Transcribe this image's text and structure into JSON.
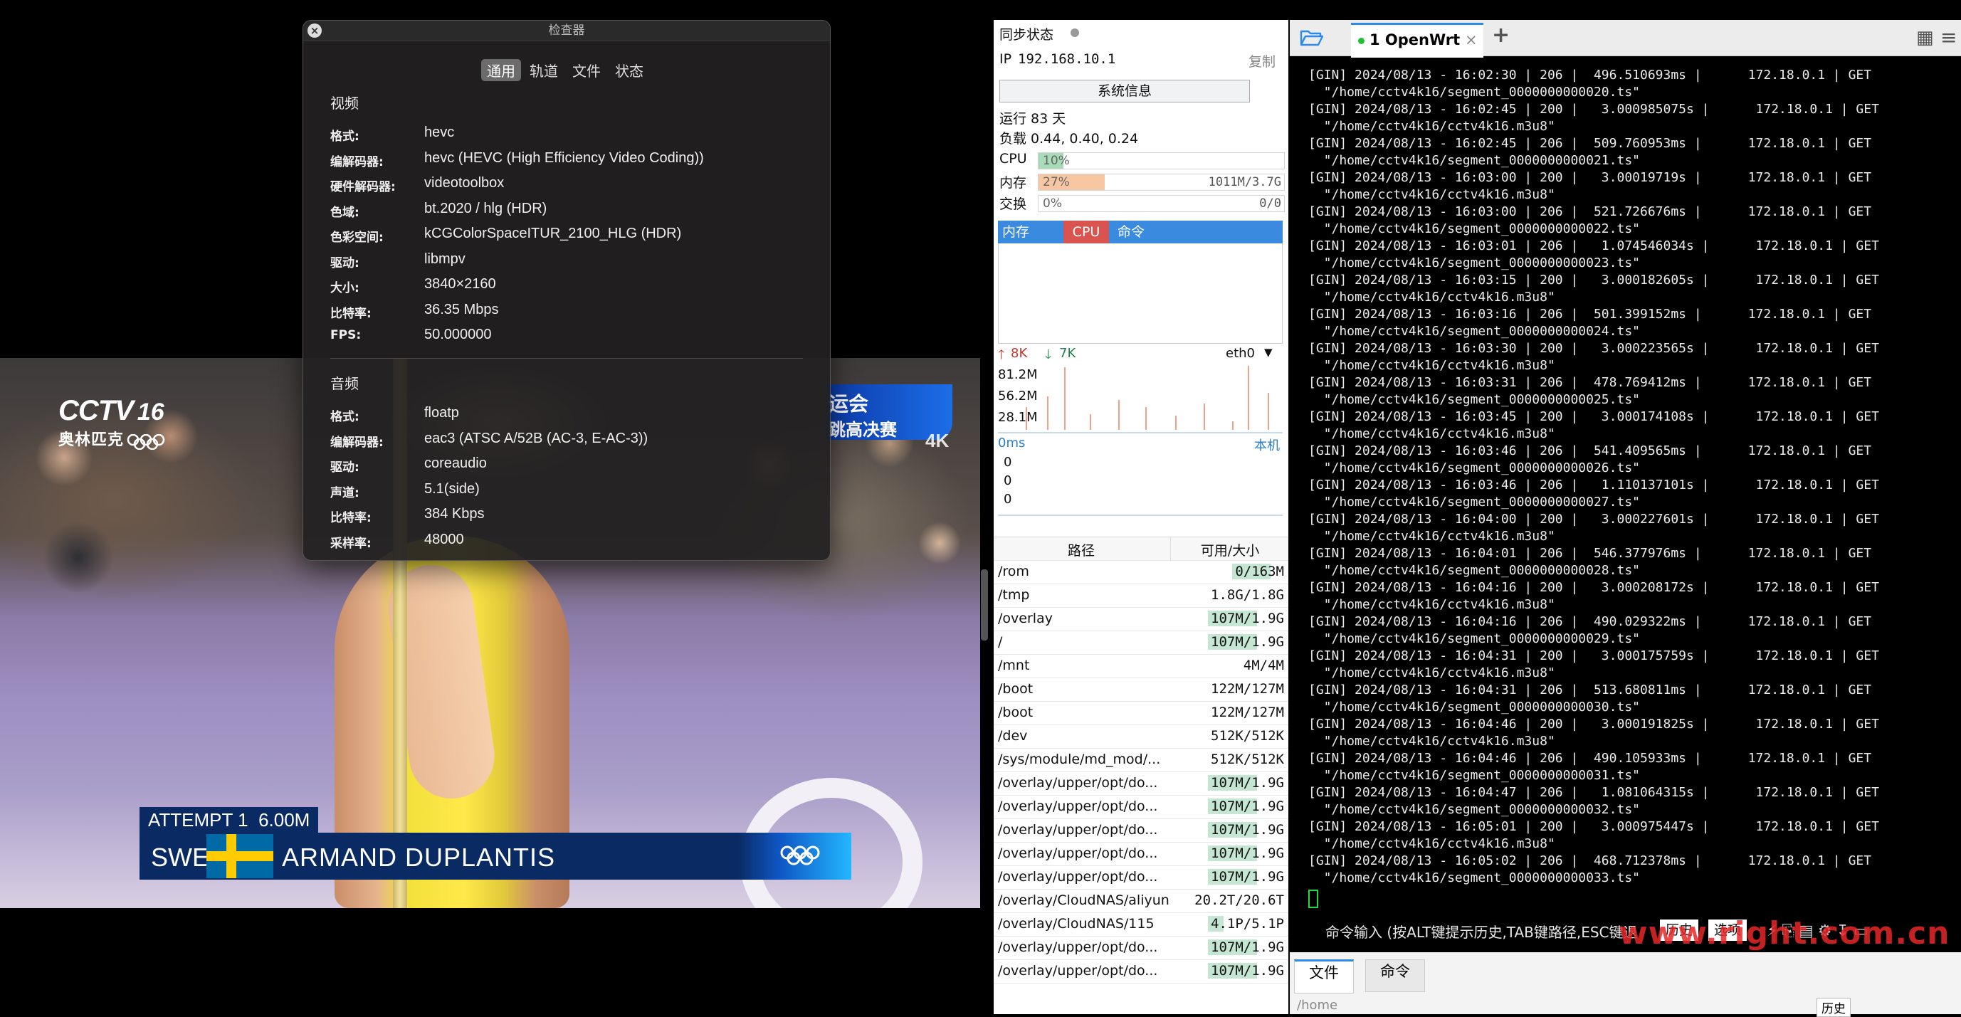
{
  "inspector": {
    "title": "检查器",
    "tabs": [
      "通用",
      "轨道",
      "文件",
      "状态"
    ],
    "video_title": "视频",
    "video_rows": [
      {
        "k": "格式:",
        "v": "hevc"
      },
      {
        "k": "编解码器:",
        "v": "hevc (HEVC (High Efficiency Video Coding))"
      },
      {
        "k": "硬件解码器:",
        "v": "videotoolbox"
      },
      {
        "k": "色域:",
        "v": "bt.2020 / hlg (HDR)"
      },
      {
        "k": "色彩空间:",
        "v": "kCGColorSpaceITUR_2100_HLG (HDR)"
      },
      {
        "k": "驱动:",
        "v": "libmpv"
      },
      {
        "k": "大小:",
        "v": "3840×2160"
      },
      {
        "k": "比特率:",
        "v": "36.35 Mbps"
      },
      {
        "k": "FPS:",
        "v": "50.000000"
      }
    ],
    "audio_title": "音频",
    "audio_rows": [
      {
        "k": "格式:",
        "v": "floatp"
      },
      {
        "k": "编解码器:",
        "v": "eac3 (ATSC A/52B (AC-3, E-AC-3))"
      },
      {
        "k": "驱动:",
        "v": "coreaudio"
      },
      {
        "k": "声道:",
        "v": "5.1(side)"
      },
      {
        "k": "比特率:",
        "v": "384 Kbps"
      },
      {
        "k": "采样率:",
        "v": "48000"
      }
    ]
  },
  "video": {
    "channel": "CCTV",
    "channel_num": "16",
    "channel_sub": "奥林匹克",
    "badge": "4K",
    "event_line1": "运会",
    "event_line2": "跳高决赛",
    "attempt": "ATTEMPT 1",
    "height": "6.00M",
    "country": "SWE",
    "athlete": "ARMAND DUPLANTIS"
  },
  "wrt": {
    "sync_label": "同步状态",
    "ip_label": "IP",
    "ip": "192.168.10.1",
    "copy": "复制",
    "sysinfo_btn": "系统信息",
    "uptime": "运行 83 天",
    "load": "负载 0.44, 0.40, 0.24",
    "cpu_label": "CPU",
    "cpu_pct": "10%",
    "cpu_fraction": 0.1,
    "mem_label": "内存",
    "mem_pct": "27%",
    "mem_amount": "1011M/3.7G",
    "mem_fraction": 0.27,
    "swap_label": "交换",
    "swap_pct": "0%",
    "swap_amount": "0/0",
    "proc_tabs": [
      "内存",
      "CPU",
      "命令"
    ],
    "net_up": "8K",
    "net_down": "7K",
    "iface": "eth0",
    "net_ticks": [
      "81.2M",
      "56.2M",
      "28.1M"
    ],
    "ping_label": "0ms",
    "ping_host": "本机",
    "ping_ticks": [
      "0",
      "0",
      "0"
    ],
    "disk_head_path": "路径",
    "disk_head_size": "可用/大小",
    "disks": [
      {
        "path": "/rom",
        "size": "0/163M",
        "used": 0.7
      },
      {
        "path": "/tmp",
        "size": "1.8G/1.8G",
        "used": 0
      },
      {
        "path": "/overlay",
        "size": "107M/1.9G",
        "used": 0.62
      },
      {
        "path": "/",
        "size": "107M/1.9G",
        "used": 0.62
      },
      {
        "path": "/mnt",
        "size": "4M/4M",
        "used": 0
      },
      {
        "path": "/boot",
        "size": "122M/127M",
        "used": 0
      },
      {
        "path": "/boot",
        "size": "122M/127M",
        "used": 0
      },
      {
        "path": "/dev",
        "size": "512K/512K",
        "used": 0
      },
      {
        "path": "/sys/module/md_mod/...",
        "size": "512K/512K",
        "used": 0
      },
      {
        "path": "/overlay/upper/opt/do...",
        "size": "107M/1.9G",
        "used": 0.62
      },
      {
        "path": "/overlay/upper/opt/do...",
        "size": "107M/1.9G",
        "used": 0.62
      },
      {
        "path": "/overlay/upper/opt/do...",
        "size": "107M/1.9G",
        "used": 0.62
      },
      {
        "path": "/overlay/upper/opt/do...",
        "size": "107M/1.9G",
        "used": 0.62
      },
      {
        "path": "/overlay/upper/opt/do...",
        "size": "107M/1.9G",
        "used": 0.62
      },
      {
        "path": "/overlay/CloudNAS/aliyun",
        "size": "20.2T/20.6T",
        "used": 0
      },
      {
        "path": "/overlay/CloudNAS/115",
        "size": "4.1P/5.1P",
        "used": 0.2
      },
      {
        "path": "/overlay/upper/opt/do...",
        "size": "107M/1.9G",
        "used": 0.62
      },
      {
        "path": "/overlay/upper/opt/do...",
        "size": "107M/1.9G",
        "used": 0.62
      }
    ]
  },
  "terminal": {
    "tab_label": "1 OpenWrt",
    "log": [
      "[GIN] 2024/08/13 - 16:02:30 | 206 |  496.510693ms |      172.18.0.1 | GET",
      "  \"/home/cctv4k16/segment_0000000000020.ts\"",
      "[GIN] 2024/08/13 - 16:02:45 | 200 |   3.000985075s |      172.18.0.1 | GET",
      "  \"/home/cctv4k16/cctv4k16.m3u8\"",
      "[GIN] 2024/08/13 - 16:02:45 | 206 |  509.760953ms |      172.18.0.1 | GET",
      "  \"/home/cctv4k16/segment_0000000000021.ts\"",
      "[GIN] 2024/08/13 - 16:03:00 | 200 |   3.00019719s |      172.18.0.1 | GET",
      "  \"/home/cctv4k16/cctv4k16.m3u8\"",
      "[GIN] 2024/08/13 - 16:03:00 | 206 |  521.726676ms |      172.18.0.1 | GET",
      "  \"/home/cctv4k16/segment_0000000000022.ts\"",
      "[GIN] 2024/08/13 - 16:03:01 | 206 |   1.074546034s |      172.18.0.1 | GET",
      "  \"/home/cctv4k16/segment_0000000000023.ts\"",
      "[GIN] 2024/08/13 - 16:03:15 | 200 |   3.000182605s |      172.18.0.1 | GET",
      "  \"/home/cctv4k16/cctv4k16.m3u8\"",
      "[GIN] 2024/08/13 - 16:03:16 | 206 |  501.399152ms |      172.18.0.1 | GET",
      "  \"/home/cctv4k16/segment_0000000000024.ts\"",
      "[GIN] 2024/08/13 - 16:03:30 | 200 |   3.000223565s |      172.18.0.1 | GET",
      "  \"/home/cctv4k16/cctv4k16.m3u8\"",
      "[GIN] 2024/08/13 - 16:03:31 | 206 |  478.769412ms |      172.18.0.1 | GET",
      "  \"/home/cctv4k16/segment_0000000000025.ts\"",
      "[GIN] 2024/08/13 - 16:03:45 | 200 |   3.000174108s |      172.18.0.1 | GET",
      "  \"/home/cctv4k16/cctv4k16.m3u8\"",
      "[GIN] 2024/08/13 - 16:03:46 | 206 |  541.409565ms |      172.18.0.1 | GET",
      "  \"/home/cctv4k16/segment_0000000000026.ts\"",
      "[GIN] 2024/08/13 - 16:03:46 | 206 |   1.110137101s |      172.18.0.1 | GET",
      "  \"/home/cctv4k16/segment_0000000000027.ts\"",
      "[GIN] 2024/08/13 - 16:04:00 | 200 |   3.000227601s |      172.18.0.1 | GET",
      "  \"/home/cctv4k16/cctv4k16.m3u8\"",
      "[GIN] 2024/08/13 - 16:04:01 | 206 |  546.377976ms |      172.18.0.1 | GET",
      "  \"/home/cctv4k16/segment_0000000000028.ts\"",
      "[GIN] 2024/08/13 - 16:04:16 | 200 |   3.000208172s |      172.18.0.1 | GET",
      "  \"/home/cctv4k16/cctv4k16.m3u8\"",
      "[GIN] 2024/08/13 - 16:04:16 | 206 |  490.029322ms |      172.18.0.1 | GET",
      "  \"/home/cctv4k16/segment_0000000000029.ts\"",
      "[GIN] 2024/08/13 - 16:04:31 | 200 |   3.000175759s |      172.18.0.1 | GET",
      "  \"/home/cctv4k16/cctv4k16.m3u8\"",
      "[GIN] 2024/08/13 - 16:04:31 | 206 |  513.680811ms |      172.18.0.1 | GET",
      "  \"/home/cctv4k16/segment_0000000000030.ts\"",
      "[GIN] 2024/08/13 - 16:04:46 | 200 |   3.000191825s |      172.18.0.1 | GET",
      "  \"/home/cctv4k16/cctv4k16.m3u8\"",
      "[GIN] 2024/08/13 - 16:04:46 | 206 |  490.105933ms |      172.18.0.1 | GET",
      "  \"/home/cctv4k16/segment_0000000000031.ts\"",
      "[GIN] 2024/08/13 - 16:04:47 | 206 |   1.081064315s |      172.18.0.1 | GET",
      "  \"/home/cctv4k16/segment_0000000000032.ts\"",
      "[GIN] 2024/08/13 - 16:05:01 | 200 |   3.000975447s |      172.18.0.1 | GET",
      "  \"/home/cctv4k16/cctv4k16.m3u8\"",
      "[GIN] 2024/08/13 - 16:05:02 | 206 |  468.712378ms |      172.18.0.1 | GET",
      "  \"/home/cctv4k16/segment_0000000000033.ts\""
    ],
    "cmd_label": "命令输入 (按ALT键提示历史,TAB键路径,ESC键退",
    "history_btn": "历史",
    "options_btn": "选项",
    "bottom_tabs": [
      "文件",
      "命令"
    ],
    "bottom_path": "/home",
    "bottom_history": "历史"
  },
  "watermark": "www.right.com.cn",
  "colors": {
    "accent": "#3a8be0",
    "cpu_fill": "#a8dcb8",
    "mem_fill": "#f7c6a3",
    "cursor": "#1fdc3a"
  }
}
